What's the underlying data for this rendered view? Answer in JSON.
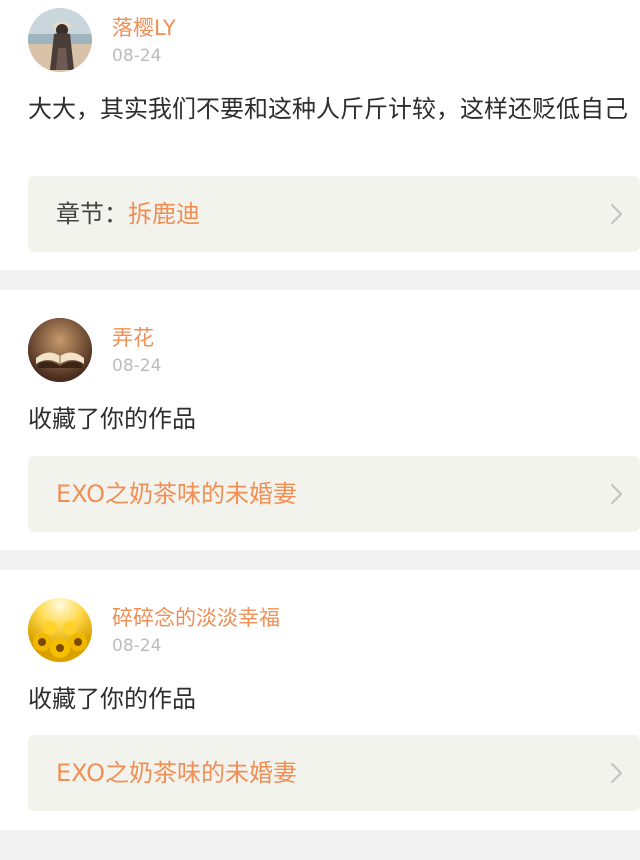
{
  "items": [
    {
      "username": "落樱LY",
      "date": "08-24",
      "text": "大大，其实我们不要和这种人斤斤计较，这样还贬低自己",
      "link_prefix": "章节：",
      "link_title": "拆鹿迪"
    },
    {
      "username": "弄花",
      "date": "08-24",
      "text": "收藏了你的作品",
      "link_prefix": "",
      "link_title": "EXO之奶茶味的未婚妻"
    },
    {
      "username": "碎碎念的淡淡幸福",
      "date": "08-24",
      "text": "收藏了你的作品",
      "link_prefix": "",
      "link_title": "EXO之奶茶味的未婚妻"
    }
  ],
  "colors": {
    "accent": "#f08f55",
    "date": "#bcbcbc",
    "link_bg": "#f3f3ee",
    "divider": "#f2f2f2"
  },
  "icons": {
    "chevron": "chevron-right-icon"
  }
}
